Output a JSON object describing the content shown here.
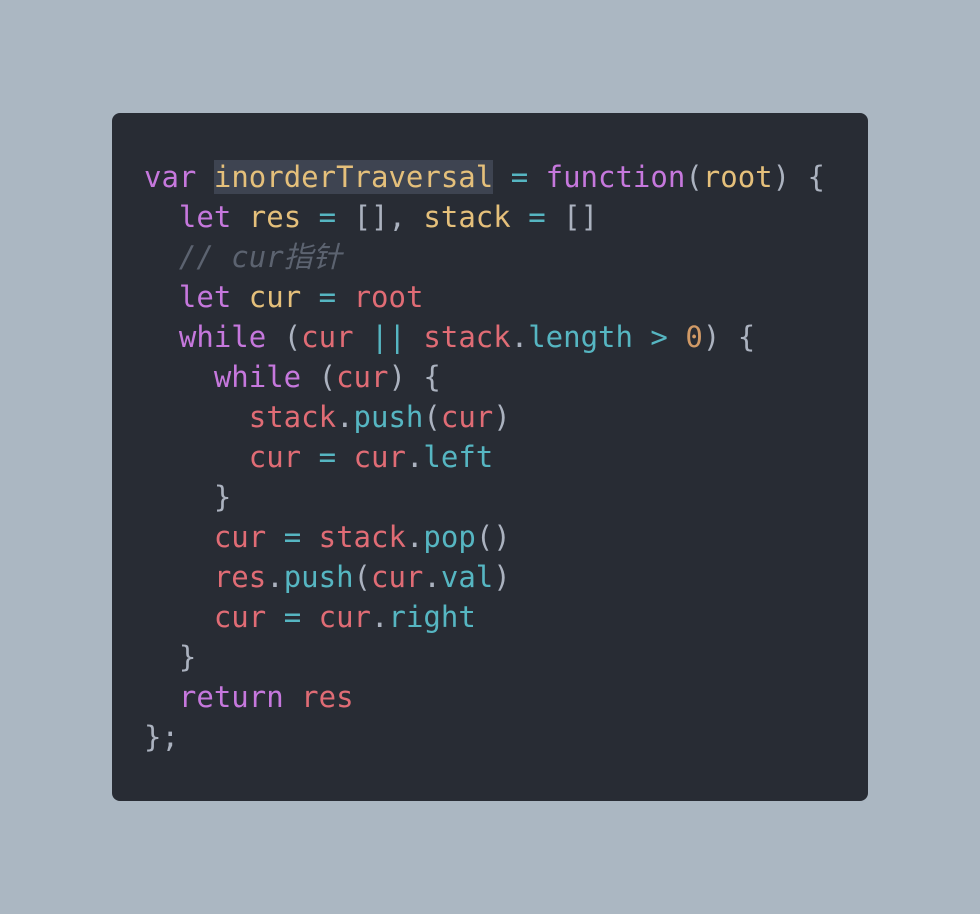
{
  "colors": {
    "page_background": "#abb7c2",
    "editor_background": "#282c34",
    "keyword": "#c678dd",
    "function_name": "#e5c07b",
    "operator": "#56b6c2",
    "punctuation": "#abb2bf",
    "variable": "#e06c75",
    "property": "#56b6c2",
    "number": "#d19a66",
    "comment": "#5c6370",
    "selection_highlight": "#3e4451"
  },
  "code": {
    "language": "javascript",
    "highlighted_token": "inorderTraversal",
    "lines": [
      [
        {
          "t": "kw",
          "v": "var"
        },
        {
          "t": "pn",
          "v": " "
        },
        {
          "t": "fn hl",
          "v": "inorderTraversal"
        },
        {
          "t": "pn",
          "v": " "
        },
        {
          "t": "op",
          "v": "="
        },
        {
          "t": "pn",
          "v": " "
        },
        {
          "t": "kw",
          "v": "function"
        },
        {
          "t": "pn",
          "v": "("
        },
        {
          "t": "fn",
          "v": "root"
        },
        {
          "t": "pn",
          "v": ") {"
        }
      ],
      [
        {
          "t": "pn",
          "v": "  "
        },
        {
          "t": "kw",
          "v": "let"
        },
        {
          "t": "pn",
          "v": " "
        },
        {
          "t": "fn",
          "v": "res"
        },
        {
          "t": "pn",
          "v": " "
        },
        {
          "t": "op",
          "v": "="
        },
        {
          "t": "pn",
          "v": " [], "
        },
        {
          "t": "fn",
          "v": "stack"
        },
        {
          "t": "pn",
          "v": " "
        },
        {
          "t": "op",
          "v": "="
        },
        {
          "t": "pn",
          "v": " []"
        }
      ],
      [
        {
          "t": "pn",
          "v": "  "
        },
        {
          "t": "cm",
          "v": "// cur指针"
        }
      ],
      [
        {
          "t": "pn",
          "v": "  "
        },
        {
          "t": "kw",
          "v": "let"
        },
        {
          "t": "pn",
          "v": " "
        },
        {
          "t": "fn",
          "v": "cur"
        },
        {
          "t": "pn",
          "v": " "
        },
        {
          "t": "op",
          "v": "="
        },
        {
          "t": "pn",
          "v": " "
        },
        {
          "t": "vr",
          "v": "root"
        }
      ],
      [
        {
          "t": "pn",
          "v": "  "
        },
        {
          "t": "kw",
          "v": "while"
        },
        {
          "t": "pn",
          "v": " ("
        },
        {
          "t": "vr",
          "v": "cur"
        },
        {
          "t": "pn",
          "v": " "
        },
        {
          "t": "op",
          "v": "||"
        },
        {
          "t": "pn",
          "v": " "
        },
        {
          "t": "vr",
          "v": "stack"
        },
        {
          "t": "pn",
          "v": "."
        },
        {
          "t": "pr",
          "v": "length"
        },
        {
          "t": "pn",
          "v": " "
        },
        {
          "t": "op",
          "v": ">"
        },
        {
          "t": "pn",
          "v": " "
        },
        {
          "t": "nm",
          "v": "0"
        },
        {
          "t": "pn",
          "v": ") {"
        }
      ],
      [
        {
          "t": "pn",
          "v": "    "
        },
        {
          "t": "kw",
          "v": "while"
        },
        {
          "t": "pn",
          "v": " ("
        },
        {
          "t": "vr",
          "v": "cur"
        },
        {
          "t": "pn",
          "v": ") {"
        }
      ],
      [
        {
          "t": "pn",
          "v": "      "
        },
        {
          "t": "vr",
          "v": "stack"
        },
        {
          "t": "pn",
          "v": "."
        },
        {
          "t": "pr",
          "v": "push"
        },
        {
          "t": "pn",
          "v": "("
        },
        {
          "t": "vr",
          "v": "cur"
        },
        {
          "t": "pn",
          "v": ")"
        }
      ],
      [
        {
          "t": "pn",
          "v": "      "
        },
        {
          "t": "vr",
          "v": "cur"
        },
        {
          "t": "pn",
          "v": " "
        },
        {
          "t": "op",
          "v": "="
        },
        {
          "t": "pn",
          "v": " "
        },
        {
          "t": "vr",
          "v": "cur"
        },
        {
          "t": "pn",
          "v": "."
        },
        {
          "t": "pr",
          "v": "left"
        }
      ],
      [
        {
          "t": "pn",
          "v": "    }"
        }
      ],
      [
        {
          "t": "pn",
          "v": "    "
        },
        {
          "t": "vr",
          "v": "cur"
        },
        {
          "t": "pn",
          "v": " "
        },
        {
          "t": "op",
          "v": "="
        },
        {
          "t": "pn",
          "v": " "
        },
        {
          "t": "vr",
          "v": "stack"
        },
        {
          "t": "pn",
          "v": "."
        },
        {
          "t": "pr",
          "v": "pop"
        },
        {
          "t": "pn",
          "v": "()"
        }
      ],
      [
        {
          "t": "pn",
          "v": "    "
        },
        {
          "t": "vr",
          "v": "res"
        },
        {
          "t": "pn",
          "v": "."
        },
        {
          "t": "pr",
          "v": "push"
        },
        {
          "t": "pn",
          "v": "("
        },
        {
          "t": "vr",
          "v": "cur"
        },
        {
          "t": "pn",
          "v": "."
        },
        {
          "t": "pr",
          "v": "val"
        },
        {
          "t": "pn",
          "v": ")"
        }
      ],
      [
        {
          "t": "pn",
          "v": "    "
        },
        {
          "t": "vr",
          "v": "cur"
        },
        {
          "t": "pn",
          "v": " "
        },
        {
          "t": "op",
          "v": "="
        },
        {
          "t": "pn",
          "v": " "
        },
        {
          "t": "vr",
          "v": "cur"
        },
        {
          "t": "pn",
          "v": "."
        },
        {
          "t": "pr",
          "v": "right"
        }
      ],
      [
        {
          "t": "pn",
          "v": "  }"
        }
      ],
      [
        {
          "t": "pn",
          "v": "  "
        },
        {
          "t": "kw",
          "v": "return"
        },
        {
          "t": "pn",
          "v": " "
        },
        {
          "t": "vr",
          "v": "res"
        }
      ],
      [
        {
          "t": "pn",
          "v": "};"
        }
      ]
    ]
  }
}
